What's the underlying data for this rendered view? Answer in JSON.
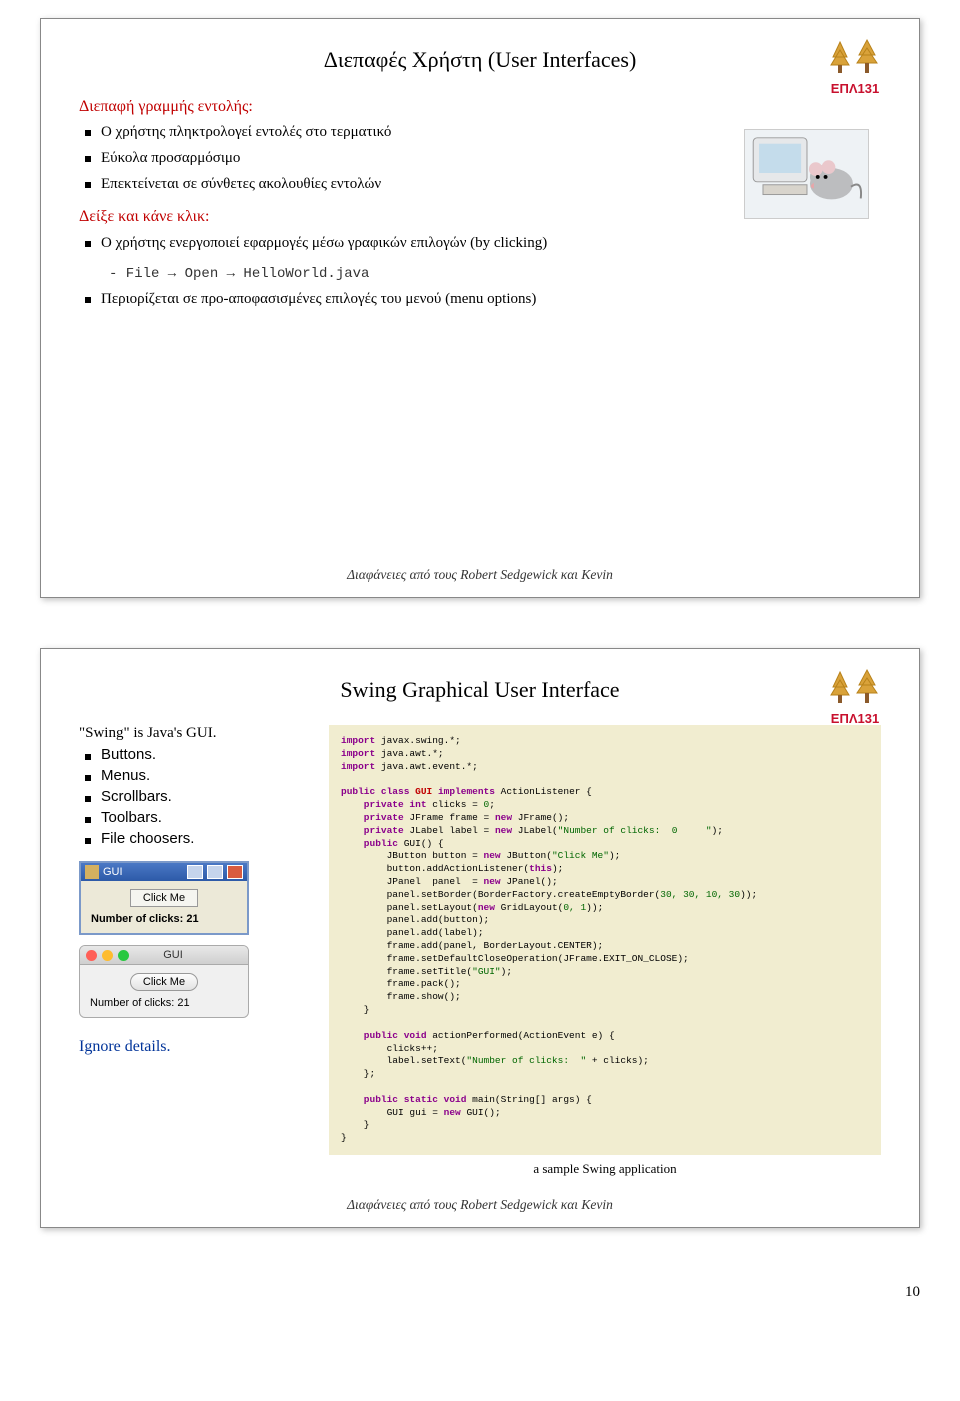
{
  "logo_label": "ΕΠΛ131",
  "footer": "Διαφάνειες από τους Robert Sedgewick και Kevin",
  "page_number": "10",
  "slide1": {
    "title": "Διεπαφές Χρήστη (User Interfaces)",
    "section1_head": "Διεπαφή γραμμής εντολής:",
    "section1_items": [
      "Ο χρήστης πληκτρολογεί εντολές στο τερματικό",
      "Εύκολα προσαρμόσιμο",
      "Επεκτείνεται σε σύνθετες ακολουθίες εντολών"
    ],
    "section2_head": "Δείξε και κάνε κλικ:",
    "section2_item1": "Ο χρήστης ενεργοποιεί εφαρμογές μέσω γραφικών επιλογών (by clicking)",
    "section2_sub": "- File → Open → HelloWorld.java",
    "section2_item2": "Περιορίζεται σε προ-αποφασισμένες επιλογές του μενού (menu options)"
  },
  "slide2": {
    "title": "Swing Graphical User Interface",
    "intro": "\"Swing\" is Java's GUI.",
    "items": [
      "Buttons.",
      "Menus.",
      "Scrollbars.",
      "Toolbars.",
      "File choosers."
    ],
    "ignore": "Ignore details.",
    "caption": "a sample Swing application",
    "gui_win": {
      "title": "GUI",
      "button": "Click Me",
      "label": "Number of clicks: 21"
    },
    "mac_win": {
      "title": "GUI",
      "button": "Click Me",
      "label": "Number of clicks: 21"
    },
    "code_lines": [
      {
        "t": "import",
        "c": "kw"
      },
      {
        "t": " javax.swing.*;\n"
      },
      {
        "t": "import",
        "c": "kw"
      },
      {
        "t": " java.awt.*;\n"
      },
      {
        "t": "import",
        "c": "kw"
      },
      {
        "t": " java.awt.event.*;\n\n"
      },
      {
        "t": "public class ",
        "c": "kw"
      },
      {
        "t": "GUI ",
        "c": "typ"
      },
      {
        "t": "implements ",
        "c": "kw"
      },
      {
        "t": "ActionListener {\n"
      },
      {
        "t": "    private int ",
        "c": "kw"
      },
      {
        "t": "clicks = "
      },
      {
        "t": "0",
        "c": "num"
      },
      {
        "t": ";\n"
      },
      {
        "t": "    private ",
        "c": "kw"
      },
      {
        "t": "JFrame frame = "
      },
      {
        "t": "new ",
        "c": "kw"
      },
      {
        "t": "JFrame();\n"
      },
      {
        "t": "    private ",
        "c": "kw"
      },
      {
        "t": "JLabel label = "
      },
      {
        "t": "new ",
        "c": "kw"
      },
      {
        "t": "JLabel("
      },
      {
        "t": "\"Number of clicks:  0     \"",
        "c": "num"
      },
      {
        "t": ");\n"
      },
      {
        "t": "    public ",
        "c": "kw"
      },
      {
        "t": "GUI() {\n"
      },
      {
        "t": "        JButton button = "
      },
      {
        "t": "new ",
        "c": "kw"
      },
      {
        "t": "JButton("
      },
      {
        "t": "\"Click Me\"",
        "c": "num"
      },
      {
        "t": ");\n"
      },
      {
        "t": "        button.addActionListener("
      },
      {
        "t": "this",
        "c": "kw"
      },
      {
        "t": ");\n"
      },
      {
        "t": "        JPanel  panel  = "
      },
      {
        "t": "new ",
        "c": "kw"
      },
      {
        "t": "JPanel();\n"
      },
      {
        "t": "        panel.setBorder(BorderFactory.createEmptyBorder("
      },
      {
        "t": "30, 30, 10, 30",
        "c": "num"
      },
      {
        "t": "));\n"
      },
      {
        "t": "        panel.setLayout("
      },
      {
        "t": "new ",
        "c": "kw"
      },
      {
        "t": "GridLayout("
      },
      {
        "t": "0, 1",
        "c": "num"
      },
      {
        "t": "));\n"
      },
      {
        "t": "        panel.add(button);\n"
      },
      {
        "t": "        panel.add(label);\n"
      },
      {
        "t": "        frame.add(panel, BorderLayout.CENTER);\n"
      },
      {
        "t": "        frame.setDefaultCloseOperation(JFrame.EXIT_ON_CLOSE);\n"
      },
      {
        "t": "        frame.setTitle("
      },
      {
        "t": "\"GUI\"",
        "c": "num"
      },
      {
        "t": ");\n"
      },
      {
        "t": "        frame.pack();\n"
      },
      {
        "t": "        frame.show();\n"
      },
      {
        "t": "    }\n\n"
      },
      {
        "t": "    public void ",
        "c": "kw"
      },
      {
        "t": "actionPerformed(ActionEvent e) {\n"
      },
      {
        "t": "        clicks++;\n"
      },
      {
        "t": "        label.setText("
      },
      {
        "t": "\"Number of clicks:  \"",
        "c": "num"
      },
      {
        "t": " + clicks);\n"
      },
      {
        "t": "    };\n\n"
      },
      {
        "t": "    public static void ",
        "c": "kw"
      },
      {
        "t": "main(String[] args) {\n"
      },
      {
        "t": "        GUI gui = "
      },
      {
        "t": "new ",
        "c": "kw"
      },
      {
        "t": "GUI();\n"
      },
      {
        "t": "    }\n"
      },
      {
        "t": "}\n"
      }
    ]
  }
}
